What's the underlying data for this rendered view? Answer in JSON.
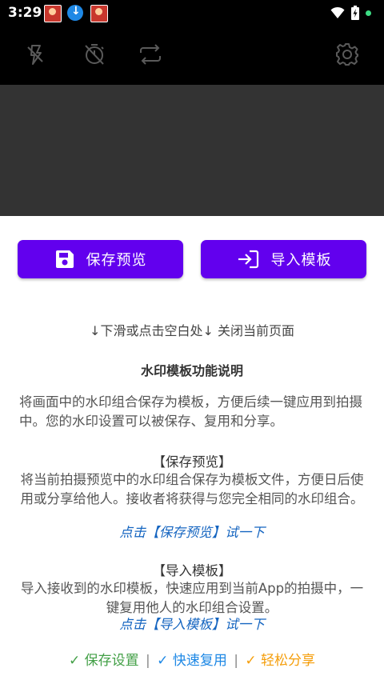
{
  "status_bar": {
    "time": "3:29",
    "notification_icons": [
      "app-avatar-icon",
      "download-icon",
      "app-avatar-icon"
    ],
    "right_icons": [
      "wifi-icon",
      "battery-charging-icon",
      "green-dot-indicator"
    ]
  },
  "camera_toolbar": {
    "icons": [
      "flash-off-icon",
      "timer-off-icon",
      "switch-camera-icon",
      "settings-gear-icon"
    ]
  },
  "actions": {
    "save_label": "保存预览",
    "import_label": "导入模板",
    "accent_color": "#6200ee"
  },
  "sheet": {
    "hint": "↓下滑或点击空白处↓ 关闭当前页面",
    "title": "水印模板功能说明",
    "intro": "将画面中的水印组合保存为模板，方便后续一键应用到拍摄中。您的水印设置可以被保存、复用和分享。",
    "sections": [
      {
        "heading": "【保存预览】",
        "body": "将当前拍摄预览中的水印组合保存为模板文件，方便日后使用或分享给他人。接收者将获得与您完全相同的水印组合。",
        "link": "点击【保存预览】试一下"
      },
      {
        "heading": "【导入模板】",
        "body": "导入接收到的水印模板，快速应用到当前App的拍摄中，一键复用他人的水印组合设置。",
        "link": "点击【导入模板】试一下"
      }
    ],
    "features": [
      {
        "text": "✓ 保存设置",
        "color": "#43a047"
      },
      {
        "text": "✓ 快速复用",
        "color": "#1e88e5"
      },
      {
        "text": "✓ 轻松分享",
        "color": "#f59e0b"
      }
    ],
    "separator": "|"
  }
}
